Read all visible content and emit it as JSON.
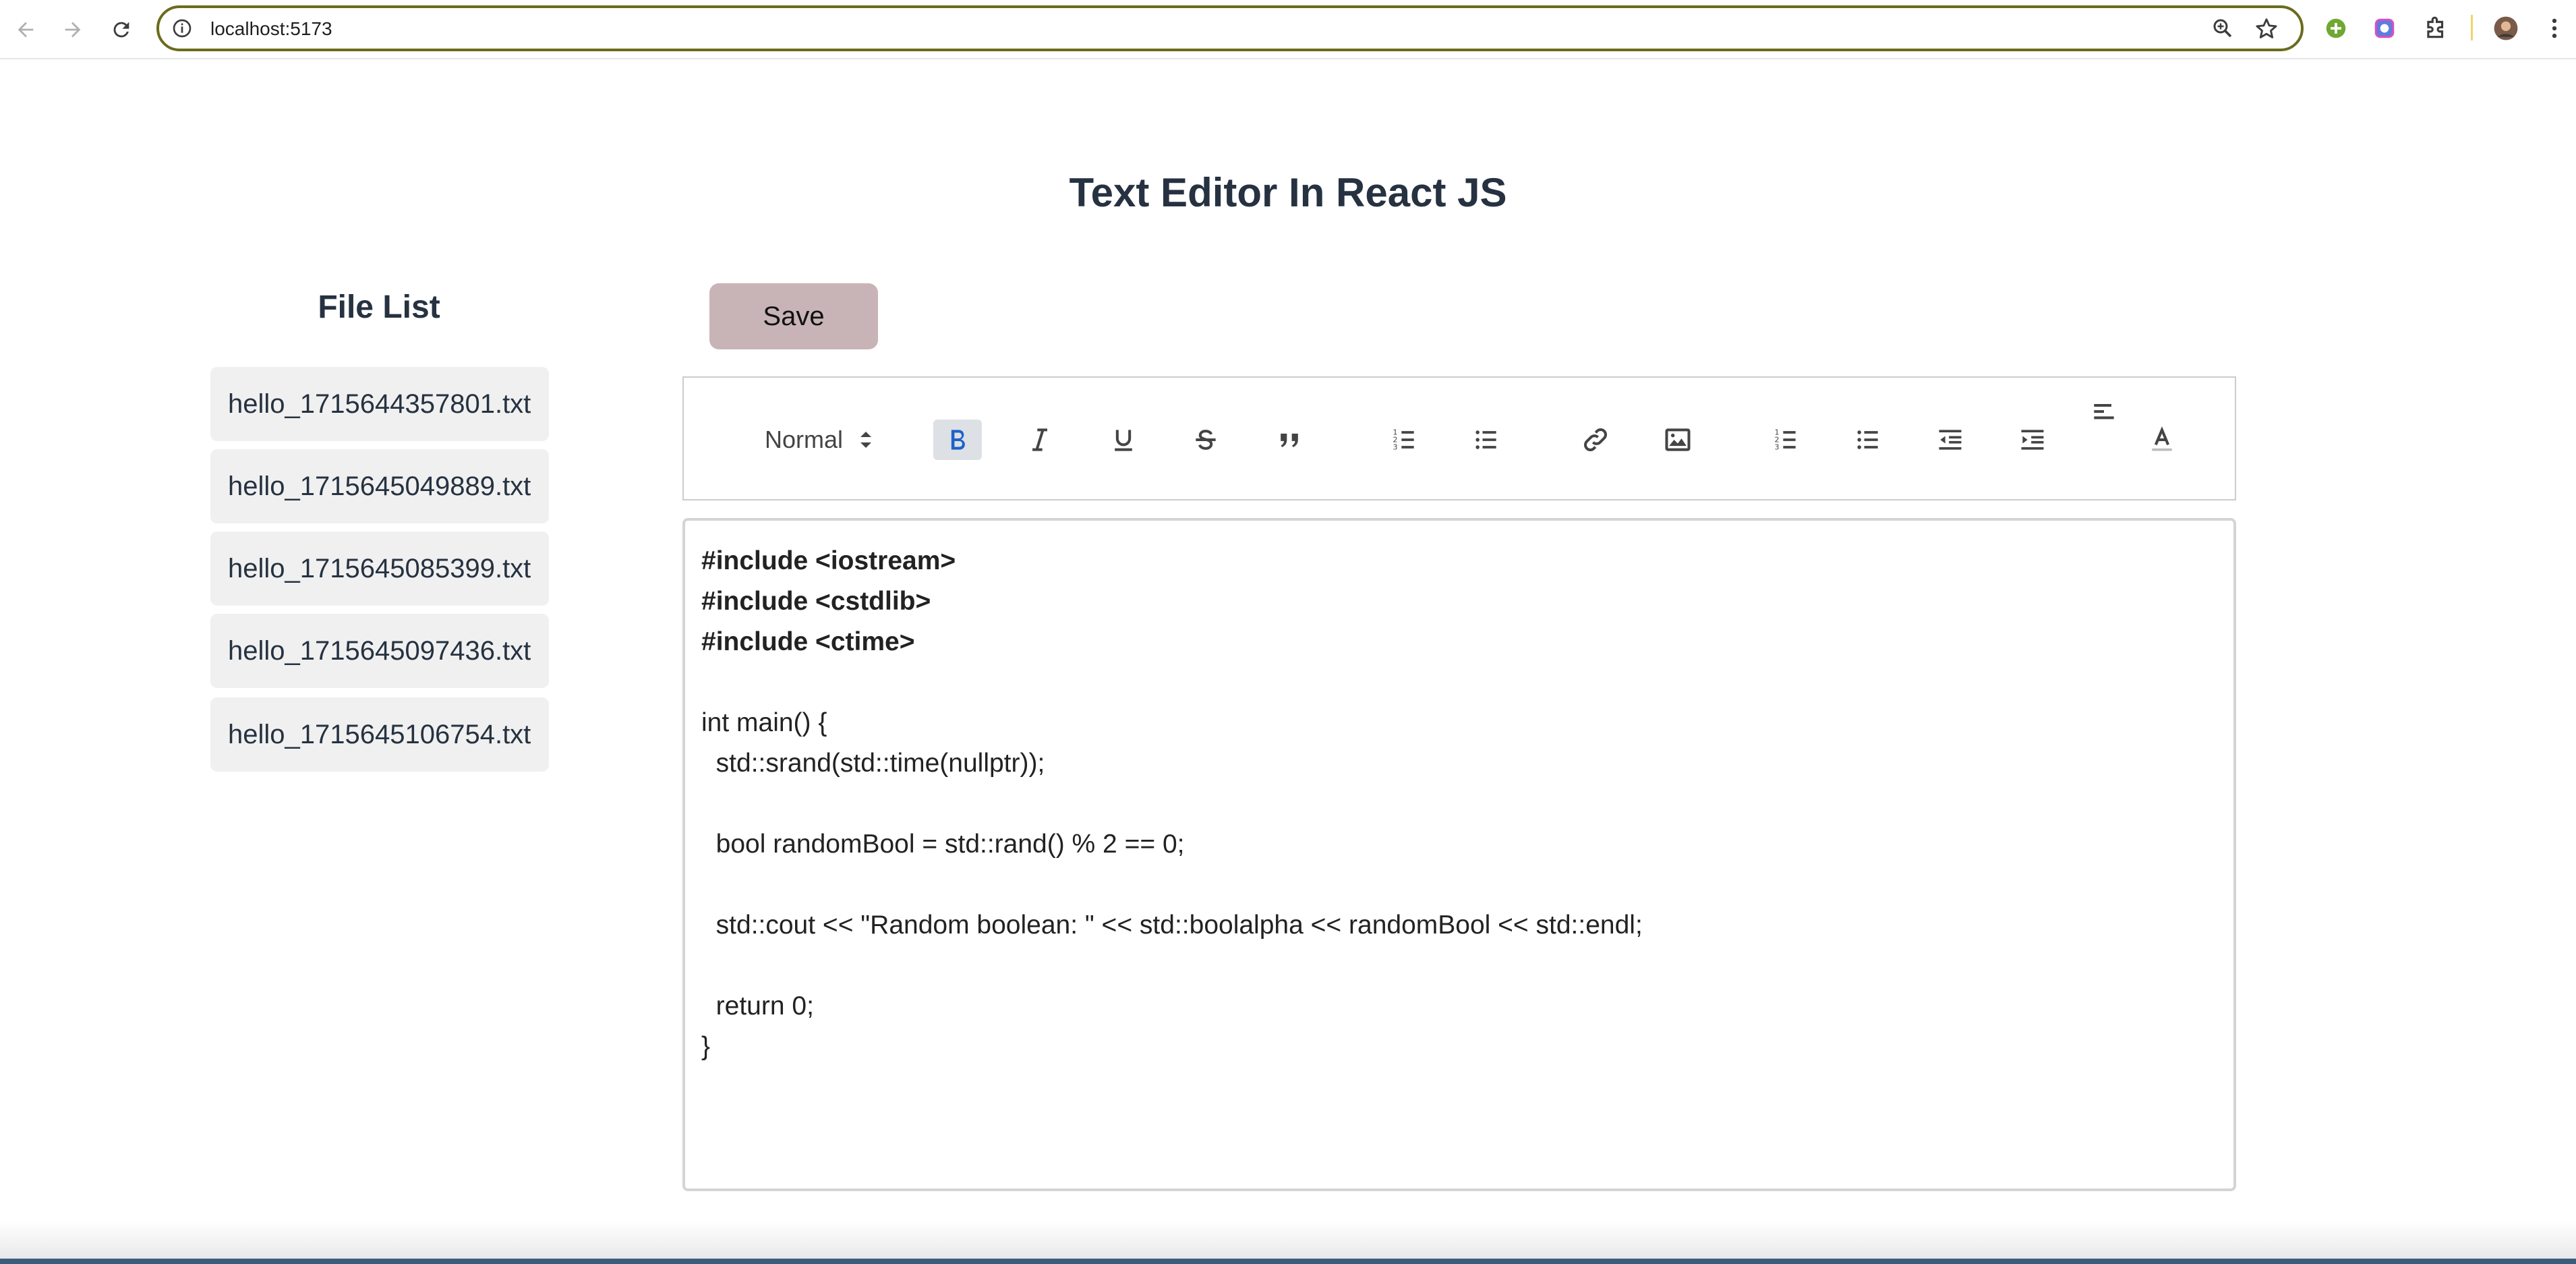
{
  "browser": {
    "url": "localhost:5173"
  },
  "page": {
    "title": "Text Editor In React JS"
  },
  "file_list": {
    "title": "File List",
    "files": [
      "hello_1715644357801.txt",
      "hello_1715645049889.txt",
      "hello_1715645085399.txt",
      "hello_1715645097436.txt",
      "hello_1715645106754.txt"
    ]
  },
  "actions": {
    "save_label": "Save"
  },
  "toolbar": {
    "header_select": "Normal",
    "active_tool": "bold",
    "tools": [
      "bold",
      "italic",
      "underline",
      "strike",
      "blockquote",
      "ordered-list",
      "bullet-list",
      "link",
      "image",
      "ordered-list",
      "bullet-list",
      "indent-decrease",
      "indent-increase",
      "align-left",
      "text-color"
    ],
    "accent_color": "#1d63c9"
  },
  "editor": {
    "lines": [
      {
        "text": "#include <iostream>",
        "bold": true
      },
      {
        "text": "#include <cstdlib>",
        "bold": true
      },
      {
        "text": "#include <ctime>",
        "bold": true
      },
      {
        "text": "",
        "bold": false
      },
      {
        "text": "int main() {",
        "bold": false
      },
      {
        "text": "  std::srand(std::time(nullptr));",
        "bold": false
      },
      {
        "text": "",
        "bold": false
      },
      {
        "text": "  bool randomBool = std::rand() % 2 == 0;",
        "bold": false
      },
      {
        "text": "",
        "bold": false
      },
      {
        "text": "  std::cout << \"Random boolean: \" << std::boolalpha << randomBool << std::endl;",
        "bold": false
      },
      {
        "text": "",
        "bold": false
      },
      {
        "text": "  return 0;",
        "bold": false
      },
      {
        "text": "}",
        "bold": false
      }
    ]
  }
}
